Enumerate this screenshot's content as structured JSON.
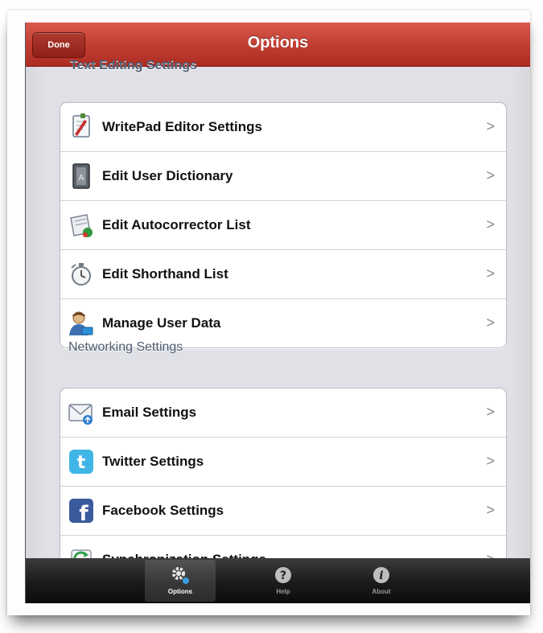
{
  "navbar": {
    "title": "Options",
    "done_label": "Done"
  },
  "sections": {
    "text_editing": {
      "header": "Text Editing Settings",
      "items": [
        {
          "label": "WritePad Editor Settings",
          "icon": "document-pen-icon"
        },
        {
          "label": "Edit User Dictionary",
          "icon": "dictionary-book-icon"
        },
        {
          "label": "Edit Autocorrector List",
          "icon": "autocorrect-list-icon"
        },
        {
          "label": "Edit Shorthand List",
          "icon": "stopwatch-icon"
        },
        {
          "label": "Manage User Data",
          "icon": "user-icon"
        }
      ]
    },
    "networking": {
      "header": "Networking Settings",
      "items": [
        {
          "label": "Email Settings",
          "icon": "email-icon"
        },
        {
          "label": "Twitter Settings",
          "icon": "twitter-icon"
        },
        {
          "label": "Facebook Settings",
          "icon": "facebook-icon"
        },
        {
          "label": "Synchronization Settings",
          "icon": "sync-icon"
        }
      ]
    }
  },
  "chevron": ">",
  "tabbar": {
    "tabs": [
      {
        "label": "Options",
        "icon": "gear-icon",
        "selected": true
      },
      {
        "label": "Help",
        "icon": "help-icon",
        "selected": false
      },
      {
        "label": "About",
        "icon": "info-icon",
        "selected": false
      }
    ]
  },
  "colors": {
    "navbar": "#c23e33",
    "section_header": "#4f5d73",
    "tabbar": "#1d1d1d"
  }
}
